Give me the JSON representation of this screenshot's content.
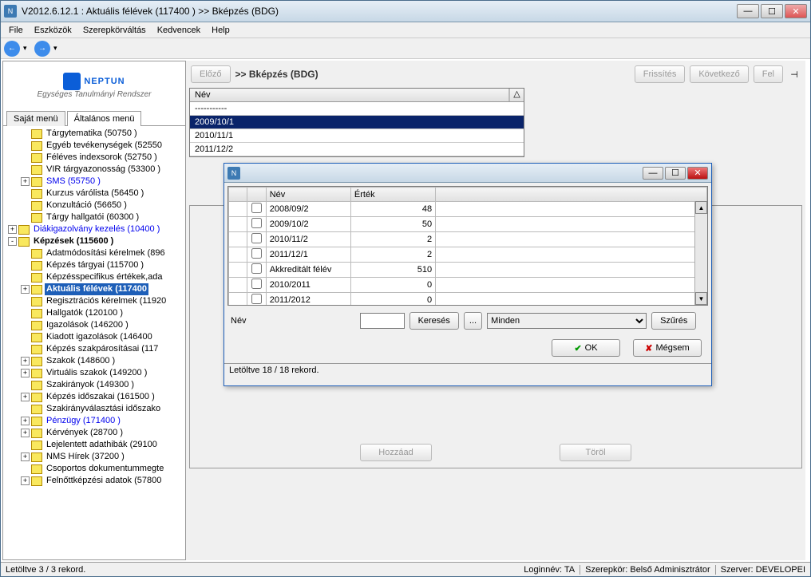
{
  "titlebar": {
    "title": "V2012.6.12.1 : Aktuális félévek (117400  )  >> Bképzés (BDG)"
  },
  "menu": [
    "File",
    "Eszközök",
    "Szerepkörváltás",
    "Kedvencek",
    "Help"
  ],
  "logo": {
    "name": "NEPTUN",
    "sub": "Egységes Tanulmányi Rendszer"
  },
  "tabs": {
    "t1": "Saját menü",
    "t2": "Általános menü"
  },
  "tree": [
    {
      "ind": 1,
      "exp": "",
      "label": "Tárgytematika (50750  )"
    },
    {
      "ind": 1,
      "exp": "",
      "label": "Egyéb tevékenységek (52550"
    },
    {
      "ind": 1,
      "exp": "",
      "label": "Féléves indexsorok (52750  )"
    },
    {
      "ind": 1,
      "exp": "",
      "label": "VIR tárgyazonosság (53300  )"
    },
    {
      "ind": 1,
      "exp": "+",
      "label": "SMS (55750  )",
      "blue": true
    },
    {
      "ind": 1,
      "exp": "",
      "label": "Kurzus várólista (56450  )"
    },
    {
      "ind": 1,
      "exp": "",
      "label": "Konzultáció (56650  )"
    },
    {
      "ind": 1,
      "exp": "",
      "label": "Tárgy hallgatói (60300  )"
    },
    {
      "ind": 0,
      "exp": "+",
      "label": "Diákigazolvány kezelés (10400  )",
      "blue": true
    },
    {
      "ind": 0,
      "exp": "-",
      "label": "Képzések  (115600  )",
      "bold": true
    },
    {
      "ind": 1,
      "exp": "",
      "label": "Adatmódosítási kérelmek (896"
    },
    {
      "ind": 1,
      "exp": "",
      "label": "Képzés tárgyai (115700  )"
    },
    {
      "ind": 1,
      "exp": "",
      "label": "Képzésspecifikus értékek,ada"
    },
    {
      "ind": 1,
      "exp": "+",
      "label": "Aktuális félévek  (117400",
      "sel": true
    },
    {
      "ind": 1,
      "exp": "",
      "label": "Regisztrációs kérelmek (11920"
    },
    {
      "ind": 1,
      "exp": "",
      "label": "Hallgatók (120100  )"
    },
    {
      "ind": 1,
      "exp": "",
      "label": "Igazolások (146200  )"
    },
    {
      "ind": 1,
      "exp": "",
      "label": "Kiadott igazolások (146400"
    },
    {
      "ind": 1,
      "exp": "",
      "label": "Képzés szakpárosításai (117"
    },
    {
      "ind": 1,
      "exp": "+",
      "label": "Szakok (148600  )"
    },
    {
      "ind": 1,
      "exp": "+",
      "label": "Virtuális szakok (149200  )"
    },
    {
      "ind": 1,
      "exp": "",
      "label": "Szakirányok (149300  )"
    },
    {
      "ind": 1,
      "exp": "+",
      "label": "Képzés időszakai (161500  )"
    },
    {
      "ind": 1,
      "exp": "",
      "label": "Szakirányválasztási időszako"
    },
    {
      "ind": 1,
      "exp": "+",
      "label": "Pénzügy (171400  )",
      "blue": true
    },
    {
      "ind": 1,
      "exp": "+",
      "label": "Kérvények (28700  )"
    },
    {
      "ind": 1,
      "exp": "",
      "label": "Lejelentett adathibák (29100"
    },
    {
      "ind": 1,
      "exp": "+",
      "label": "NMS Hírek (37200  )"
    },
    {
      "ind": 1,
      "exp": "",
      "label": "Csoportos dokumentummegte"
    },
    {
      "ind": 1,
      "exp": "+",
      "label": "Felnőttképzési adatok (57800"
    }
  ],
  "toolbar": {
    "prev": "Előző",
    "crumb": ">>  Bképzés (BDG)",
    "refresh": "Frissítés",
    "next": "Következő",
    "up": "Fel"
  },
  "gridhdr": "Név",
  "gridrows": [
    {
      "v": "-----------",
      "sel": false
    },
    {
      "v": "2009/10/1",
      "sel": true
    },
    {
      "v": "2010/11/1",
      "sel": false
    },
    {
      "v": "2011/12/2",
      "sel": false
    }
  ],
  "bottom": {
    "add": "Hozzáad",
    "del": "Töröl"
  },
  "status": {
    "left": "Letöltve 3 / 3 rekord.",
    "login": "Loginnév: TA",
    "role": "Szerepkör: Belső Adminisztrátor",
    "server": "Szerver: DEVELOPEI"
  },
  "dialog": {
    "hdr": {
      "c1": "Név",
      "c2": "Érték"
    },
    "rows": [
      {
        "n": "2008/09/2",
        "v": "48"
      },
      {
        "n": "2009/10/2",
        "v": "50"
      },
      {
        "n": "2010/11/2",
        "v": "2"
      },
      {
        "n": "2011/12/1",
        "v": "2"
      },
      {
        "n": "Akkreditált félév",
        "v": "510"
      },
      {
        "n": "2010/2011",
        "v": "0"
      },
      {
        "n": "2011/2012",
        "v": "0"
      }
    ],
    "filter": {
      "label": "Név",
      "search": "Keresés",
      "dots": "...",
      "all": "Minden",
      "filter": "Szűrés"
    },
    "ok": "OK",
    "cancel": "Mégsem",
    "status": "Letöltve 18 / 18 rekord."
  }
}
